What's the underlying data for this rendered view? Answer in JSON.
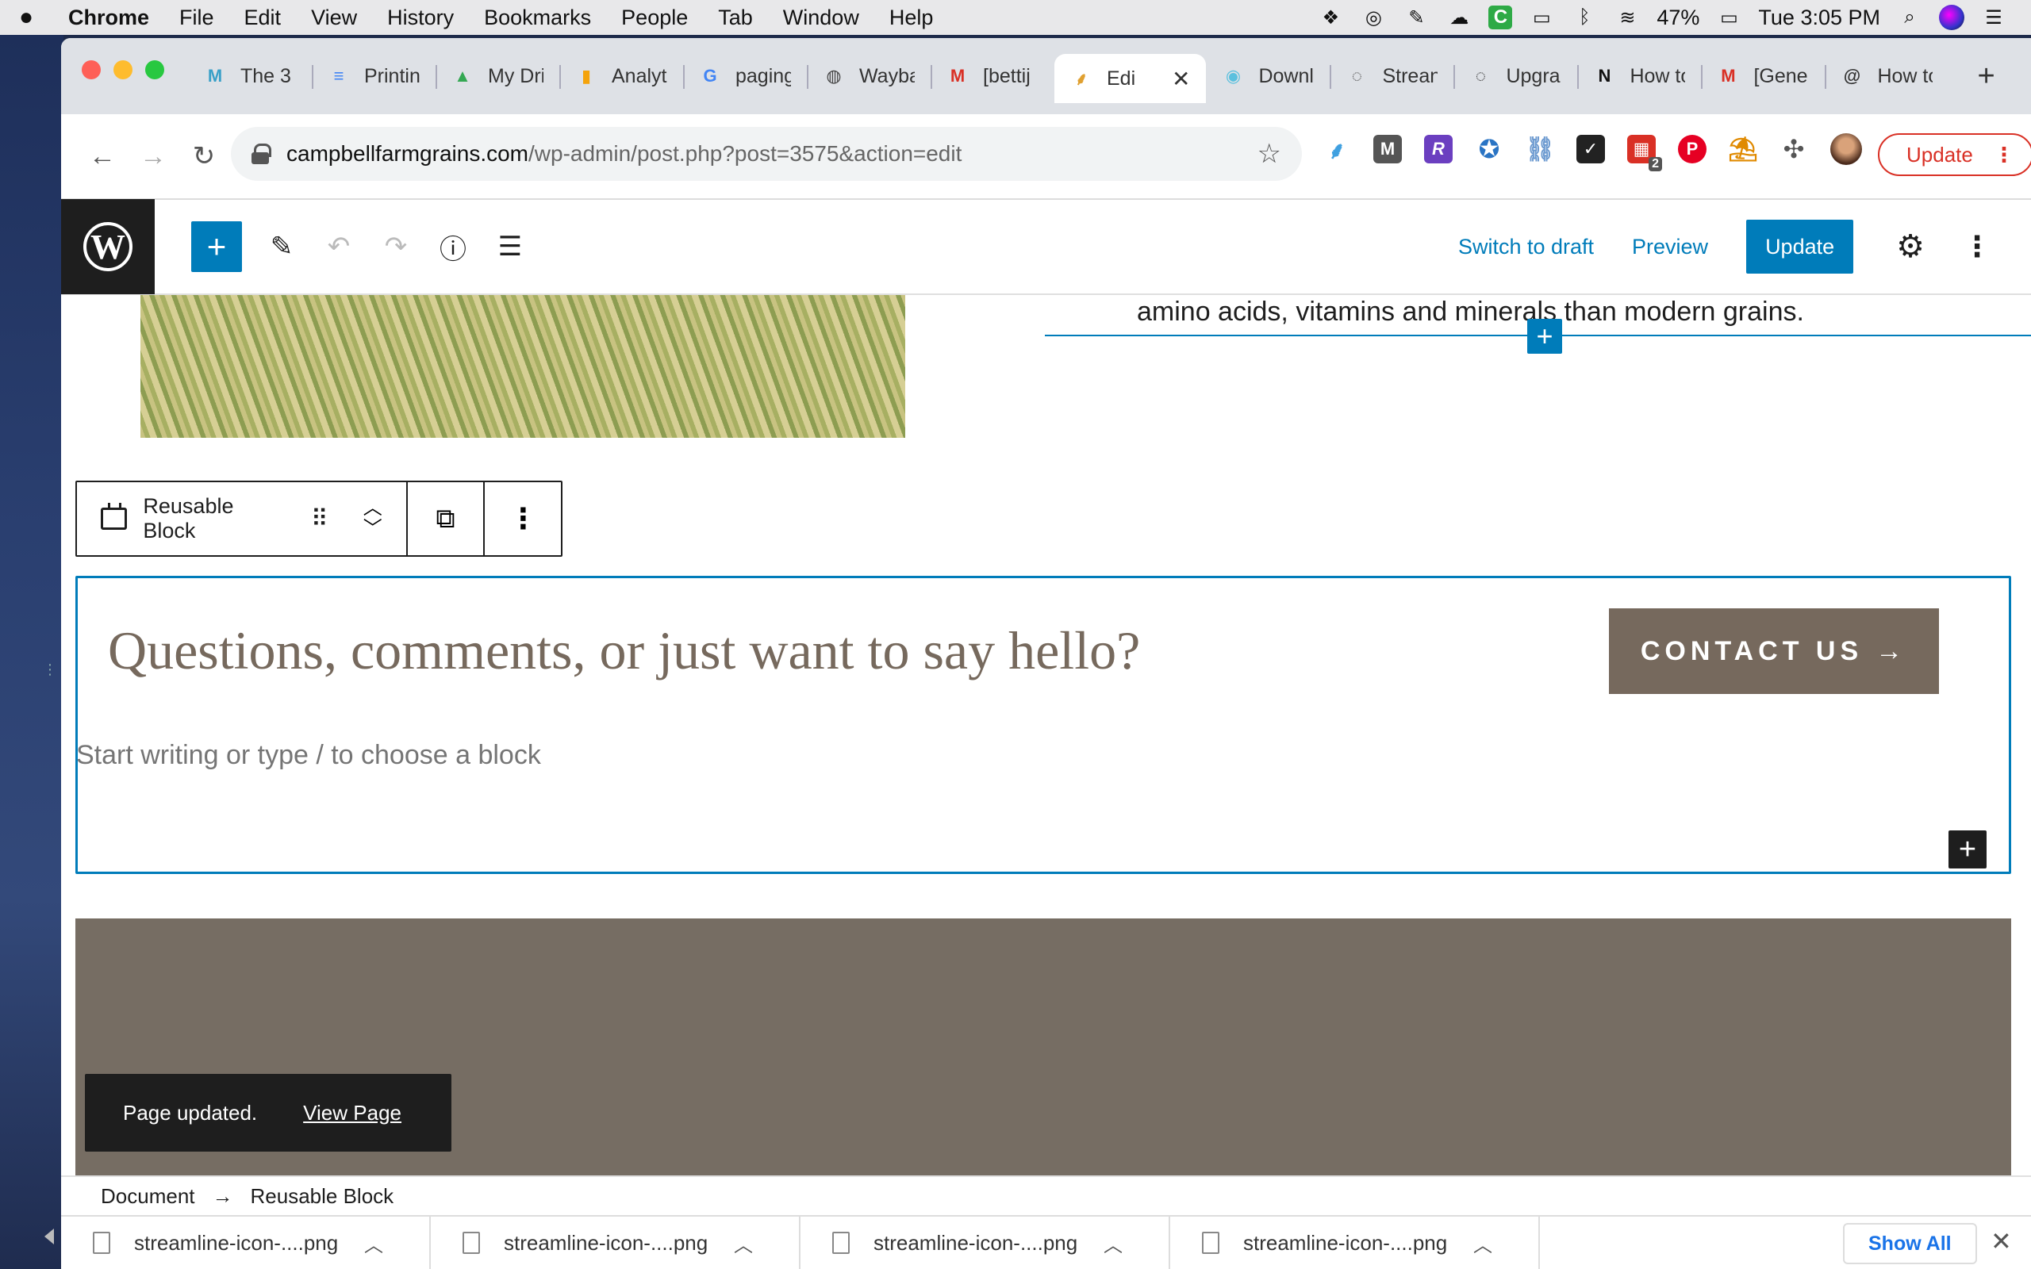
{
  "menubar": {
    "apple": "",
    "app": "Chrome",
    "items": [
      "File",
      "Edit",
      "View",
      "History",
      "Bookmarks",
      "People",
      "Tab",
      "Window",
      "Help"
    ],
    "battery": "47%",
    "clock": "Tue 3:05 PM"
  },
  "tabs": [
    {
      "title": "The 3",
      "icon": "M",
      "color": "#39a0c8"
    },
    {
      "title": "Printin",
      "icon": "≡",
      "color": "#4285f4"
    },
    {
      "title": "My Dri",
      "icon": "▲",
      "color": "#34a853"
    },
    {
      "title": "Analyt",
      "icon": "▮",
      "color": "#f4a30b"
    },
    {
      "title": "paging",
      "icon": "G",
      "color": "#4285f4"
    },
    {
      "title": "Wayba",
      "icon": "◍",
      "color": "#444444"
    },
    {
      "title": "[bettij",
      "icon": "M",
      "color": "#d93025"
    },
    {
      "title": "Edi",
      "icon": "⸙",
      "color": "#e0a030",
      "active": true
    },
    {
      "title": "Downl",
      "icon": "◉",
      "color": "#5bc0de"
    },
    {
      "title": "Strean",
      "icon": "◌",
      "color": "#444444"
    },
    {
      "title": "Upgra",
      "icon": "◌",
      "color": "#222222"
    },
    {
      "title": "How to",
      "icon": "N",
      "color": "#111111"
    },
    {
      "title": "[Gene",
      "icon": "M",
      "color": "#d93025"
    },
    {
      "title": "How to",
      "icon": "@",
      "color": "#333333"
    }
  ],
  "tab_close": "✕",
  "new_tab": "+",
  "address": {
    "host": "campbellfarmgrains.com",
    "path": "/wp-admin/post.php?post=3575&action=edit"
  },
  "chrome_update_label": "Update",
  "extension_badge": "2",
  "wp": {
    "switch_to_draft": "Switch to draft",
    "preview": "Preview",
    "update": "Update"
  },
  "content": {
    "amino_text": "amino acids, vitamins and minerals than modern grains.",
    "block_toolbar_label": "Reusable Block",
    "heading": "Questions, comments, or just want to say hello?",
    "contact_button": "CONTACT US",
    "contact_arrow": "→",
    "placeholder": "Start writing or type / to choose a block"
  },
  "snackbar": {
    "message": "Page updated.",
    "link": "View Page"
  },
  "breadcrumb": {
    "root": "Document",
    "separator": "→",
    "current": "Reusable Block"
  },
  "downloads": {
    "items": [
      "streamline-icon-....png",
      "streamline-icon-....png",
      "streamline-icon-....png",
      "streamline-icon-....png"
    ],
    "show_all": "Show All"
  },
  "colors": {
    "wp_blue": "#007cba",
    "brand_brown": "#76695d",
    "footer_brown": "#766d63"
  }
}
